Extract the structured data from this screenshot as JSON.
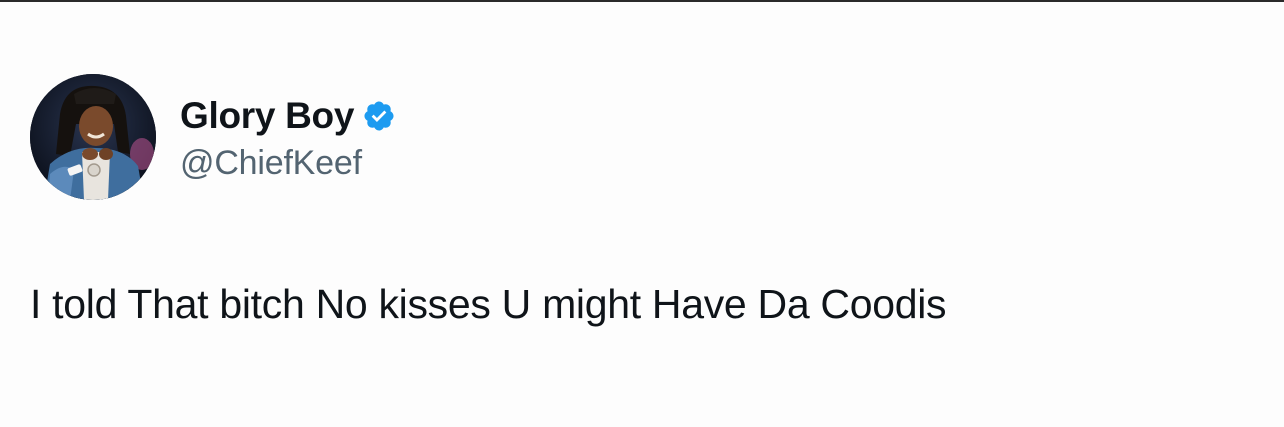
{
  "author": {
    "display_name": "Glory Boy",
    "handle": "@ChiefKeef",
    "verified": true,
    "verified_icon": "verified-badge-icon",
    "verified_color": "#1d9bf0",
    "avatar_icon": "profile-photo"
  },
  "tweet": {
    "text": "I told That bitch No kisses U might Have Da Coodis"
  },
  "colors": {
    "text_primary": "#0f1419",
    "text_secondary": "#536471",
    "background": "#ffffff"
  }
}
